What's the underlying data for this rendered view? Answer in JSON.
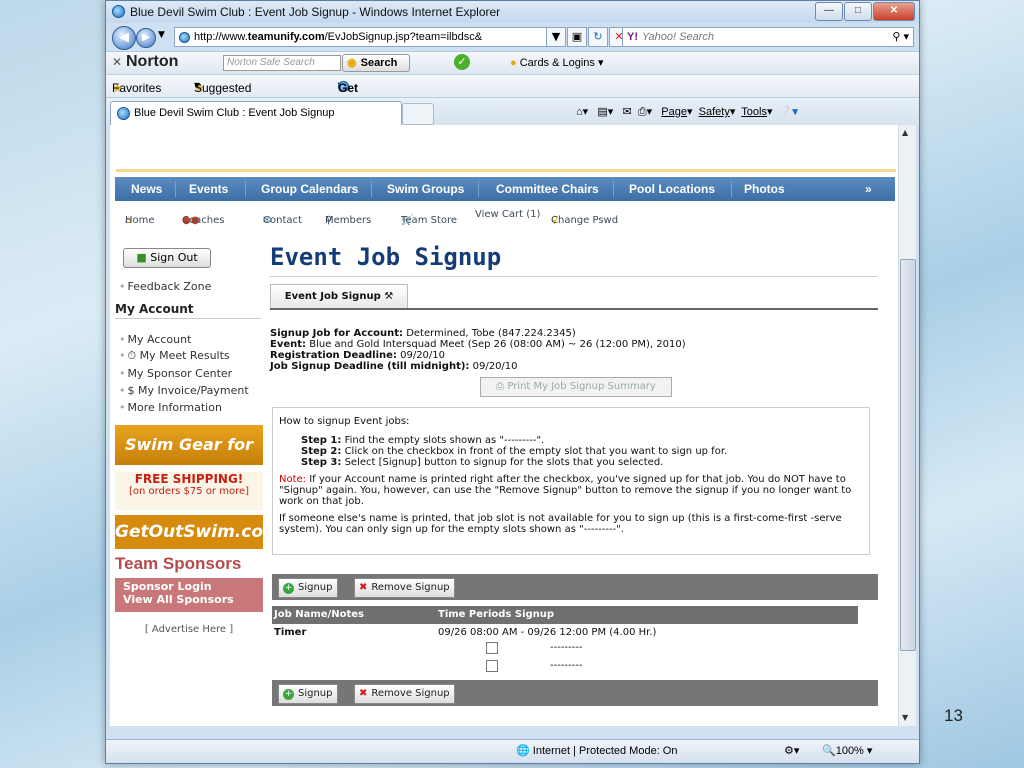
{
  "browser": {
    "window_title": "Blue Devil Swim Club : Event Job Signup - Windows Internet Explorer",
    "address_prefix": "http://www.",
    "address_domain": "teamunify.com",
    "address_path": "/EvJobSignup.jsp?team=ilbdsc&",
    "search_placeholder": "Yahoo! Search",
    "search_brand": "Y!",
    "norton_logo": "Norton",
    "norton_search_placeholder": "Norton Safe Search",
    "norton_search_button": "Search",
    "norton_cards": "Cards & Logins",
    "favorites": "Favorites",
    "suggested_sites": "Suggested Sites",
    "get_addons": "Get More Add-ons",
    "tab_title": "Blue Devil Swim Club : Event Job Signup",
    "cmd_page": "Page",
    "cmd_safety": "Safety",
    "cmd_tools": "Tools",
    "status_zone": "Internet | Protected Mode: On",
    "zoom": "100%"
  },
  "site": {
    "main_nav": [
      "News",
      "Events",
      "Group Calendars",
      "Swim Groups",
      "Committee Chairs",
      "Pool Locations",
      "Photos"
    ],
    "sub_nav": [
      "Home",
      "Coaches",
      "Contact",
      "Members",
      "Team Store",
      "View Cart (1)",
      "Change Pswd"
    ]
  },
  "sidebar": {
    "sign_out": "Sign Out",
    "feedback": "Feedback Zone",
    "my_account_heading": "My Account",
    "items": [
      "My Account",
      "My Meet Results",
      "My Sponsor Center",
      "$ My Invoice/Payment",
      "More Information"
    ],
    "ad1": "Swim Gear for Less",
    "ad2_title": "FREE SHIPPING!",
    "ad2_sub": "[on orders $75 or more]",
    "ad3": "GetOutSwim.com",
    "team_sponsors": "Team Sponsors",
    "sponsor_login": "Sponsor Login",
    "view_all_sponsors": "View All Sponsors",
    "advertise": "[ Advertise Here ]"
  },
  "main": {
    "title": "Event Job Signup",
    "tab_label": "Event Job Signup",
    "account_label": "Signup Job for Account:",
    "account_value": "Determined, Tobe (847.224.2345)",
    "event_label": "Event:",
    "event_value": "Blue and Gold Intersquad Meet (Sep 26 (08:00 AM) ~ 26 (12:00 PM), 2010)",
    "reg_label": "Registration Deadline:",
    "reg_value": "09/20/10",
    "job_deadline_label": "Job Signup Deadline (till midnight):",
    "job_deadline_value": "09/20/10",
    "print_button": "Print My Job Signup Summary",
    "howto_intro": "How to signup Event jobs:",
    "step1_label": "Step 1:",
    "step1": "Find the empty slots shown as \"---------\".",
    "step2_label": "Step 2:",
    "step2": "Click on the checkbox in front of the empty slot that you want to sign up for.",
    "step3_label": "Step 3:",
    "step3": "Select [Signup] button to signup for the slots that you selected.",
    "note_label": "Note:",
    "note_text": "If your Account name is printed right after the checkbox, you've signed up for that job. You do NOT have to \"Signup\" again. You, however, can use the \"Remove Signup\" button to remove the signup if you no longer want to work on that job.",
    "other_text": "If someone else's name is printed, that job slot is not available for you to sign up (this is a first-come-first -serve system). You can only sign up for the empty slots shown as \"---------\".",
    "signup_button": "Signup",
    "remove_button": "Remove Signup",
    "col_job": "Job Name/Notes",
    "col_time": "Time Periods Signup",
    "job_name": "Timer",
    "job_time": "09/26 08:00 AM - 09/26 12:00 PM (4.00 Hr.)",
    "slots": [
      {
        "num": "1",
        "value": "---------"
      },
      {
        "num": "2",
        "value": "---------"
      }
    ]
  },
  "slide_number": "13"
}
